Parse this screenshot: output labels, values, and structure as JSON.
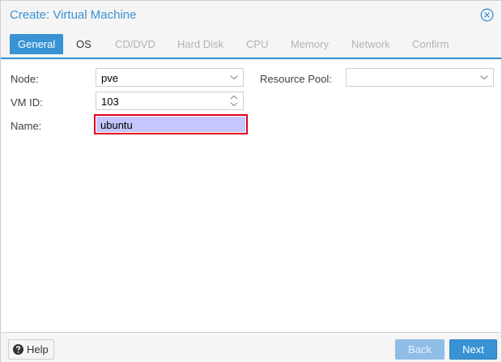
{
  "dialog": {
    "title": "Create: Virtual Machine"
  },
  "tabs": [
    {
      "label": "General",
      "state": "active"
    },
    {
      "label": "OS",
      "state": "enabled"
    },
    {
      "label": "CD/DVD",
      "state": "disabled"
    },
    {
      "label": "Hard Disk",
      "state": "disabled"
    },
    {
      "label": "CPU",
      "state": "disabled"
    },
    {
      "label": "Memory",
      "state": "disabled"
    },
    {
      "label": "Network",
      "state": "disabled"
    },
    {
      "label": "Confirm",
      "state": "disabled"
    }
  ],
  "form": {
    "node_label": "Node:",
    "node_value": "pve",
    "vmid_label": "VM ID:",
    "vmid_value": "103",
    "name_label": "Name:",
    "name_value": "ubuntu",
    "pool_label": "Resource Pool:",
    "pool_value": ""
  },
  "footer": {
    "help_label": "Help",
    "back_label": "Back",
    "next_label": "Next"
  },
  "colors": {
    "accent": "#3892d4",
    "highlight_border": "#e0001b",
    "selection": "#c5c5ff"
  },
  "icons": {
    "close": "close-circle-icon",
    "help": "question-circle-icon",
    "dropdown": "chevron-down-icon",
    "spinner": "chevron-up-down-icon"
  }
}
